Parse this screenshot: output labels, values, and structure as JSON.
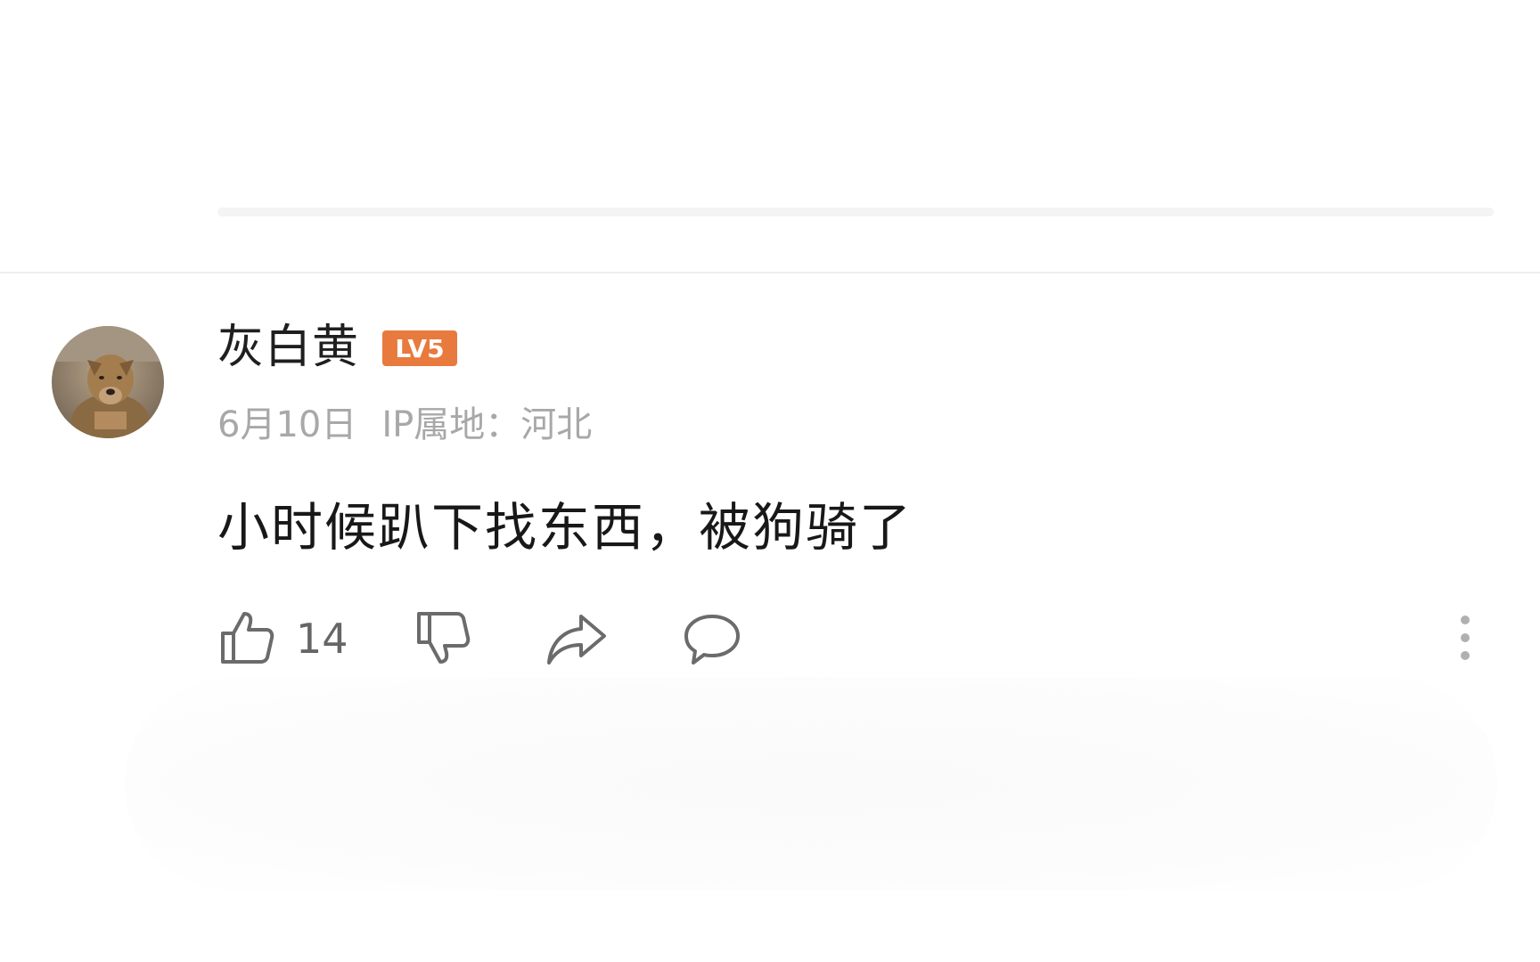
{
  "comment": {
    "username": "灰白黄",
    "level_badge": "LV5",
    "date": "6月10日",
    "ip_location": "IP属地：河北",
    "text": "小时候趴下找东西，被狗骑了",
    "like_count": "14"
  },
  "icons": {
    "like": "thumbs-up-icon",
    "dislike": "thumbs-down-icon",
    "share": "share-arrow-icon",
    "reply": "speech-bubble-icon",
    "more": "vertical-ellipsis-icon"
  },
  "colors": {
    "level_badge": "#e87a3e",
    "username": "#1f1f1f",
    "meta": "#a8a8a8",
    "icon": "#6b6b6b"
  }
}
